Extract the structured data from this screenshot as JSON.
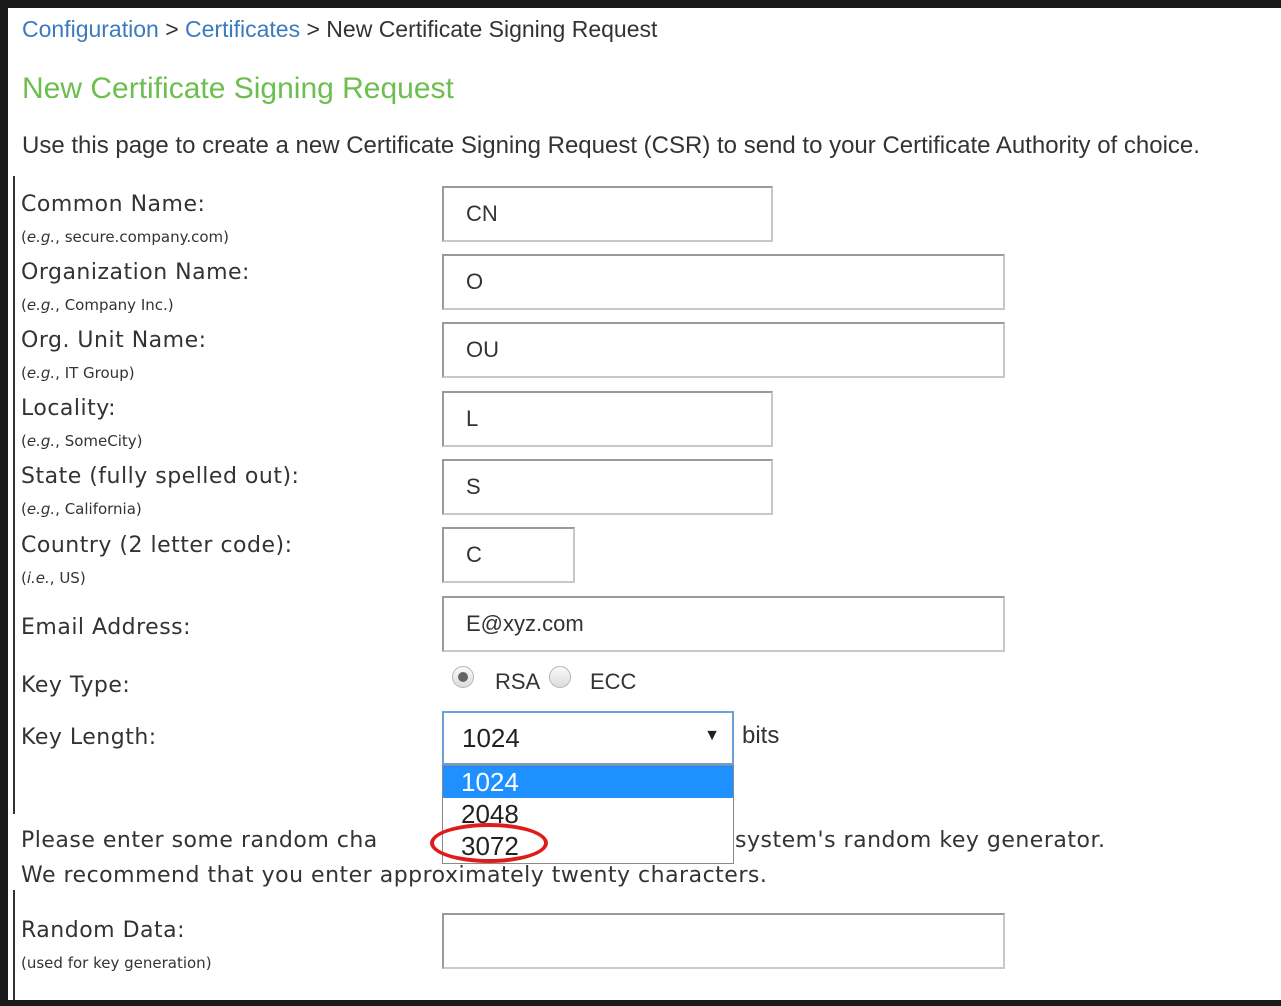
{
  "breadcrumb": {
    "items": [
      "Configuration",
      "Certificates"
    ],
    "separator": ">",
    "current": "New Certificate Signing Request"
  },
  "page_title": "New Certificate Signing Request",
  "intro": "Use this page to create a new Certificate Signing Request (CSR) to send to your Certificate Authority of choice.",
  "fields": {
    "common_name": {
      "label": "Common Name:",
      "example_prefix": "e.g.",
      "example": ", secure.company.com)",
      "value": "CN"
    },
    "organization": {
      "label": "Organization Name:",
      "example_prefix": "e.g.",
      "example": ", Company Inc.)",
      "value": "O"
    },
    "org_unit": {
      "label": "Org. Unit Name:",
      "example_prefix": "e.g.",
      "example": ", IT Group)",
      "value": "OU"
    },
    "locality": {
      "label": "Locality:",
      "example_prefix": "e.g.",
      "example": ", SomeCity)",
      "value": "L"
    },
    "state": {
      "label": "State (fully spelled out):",
      "example_prefix": "e.g.",
      "example": ", California)",
      "value": "S"
    },
    "country": {
      "label": "Country (2 letter code):",
      "example_prefix": "i.e.",
      "example": ", US)",
      "value": "C"
    },
    "email": {
      "label": "Email Address:",
      "value": "E@xyz.com"
    },
    "random_data": {
      "label": "Random Data:",
      "example": "(used for key generation)",
      "value": ""
    }
  },
  "key_type": {
    "label": "Key Type:",
    "options": [
      "RSA",
      "ECC"
    ],
    "selected": "RSA"
  },
  "key_length": {
    "label": "Key Length:",
    "selected": "1024",
    "unit": "bits",
    "options": [
      "1024",
      "2048",
      "3072"
    ]
  },
  "random_hint": {
    "line1_start": "Please enter some random cha",
    "line1_end": "system's random key generator.",
    "line2": "We recommend that you enter approximately twenty characters."
  },
  "colors": {
    "link": "#3a7bbf",
    "title": "#6cbf4e",
    "selection": "#1e90ff",
    "annotation": "#e01b1b"
  }
}
